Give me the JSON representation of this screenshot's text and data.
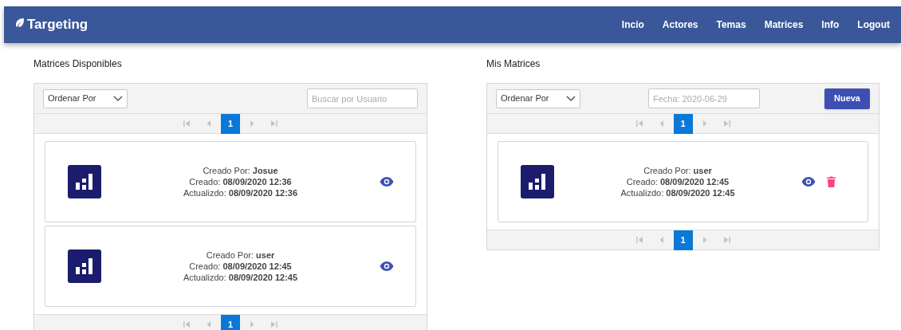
{
  "navbar": {
    "brand": "Targeting",
    "links": [
      "Incio",
      "Actores",
      "Temas",
      "Matrices",
      "Info",
      "Logout"
    ]
  },
  "panels": [
    {
      "title": "Matrices Disponibles",
      "sort": "Ordenar Por",
      "filter": {
        "placeholder": "Buscar por Usuario"
      },
      "pagination_top": [
        {
          "label": "1",
          "selected": true
        }
      ],
      "pagination_bottom": [
        {
          "label": "1",
          "selected": true
        }
      ],
      "cards": [
        {
          "lines": [
            "Creado Por: **Josue**",
            "Creado: **08/09/2020 12:36**",
            "Actualizdo: **08/09/2020 12:36**"
          ],
          "deletable": false
        },
        {
          "lines": [
            "Creado Por: **user**",
            "Creado: **08/09/2020 12:45**",
            "Actualizdo: **08/09/2020 12:45**"
          ],
          "deletable": false
        }
      ]
    },
    {
      "title": "Mis Matrices",
      "sort": "Ordenar Por",
      "filter": {
        "placeholder": "Fecha: 2020-06-29"
      },
      "new_button": "Nueva",
      "pagination_top": [
        {
          "label": "1",
          "selected": true
        }
      ],
      "pagination_bottom": [
        {
          "label": "1",
          "selected": true
        }
      ],
      "cards": [
        {
          "lines": [
            "Creado Por: **user**",
            "Creado: **08/09/2020 12:45**",
            "Actualizdo: **08/09/2020 12:45**"
          ],
          "deletable": true
        }
      ]
    }
  ]
}
